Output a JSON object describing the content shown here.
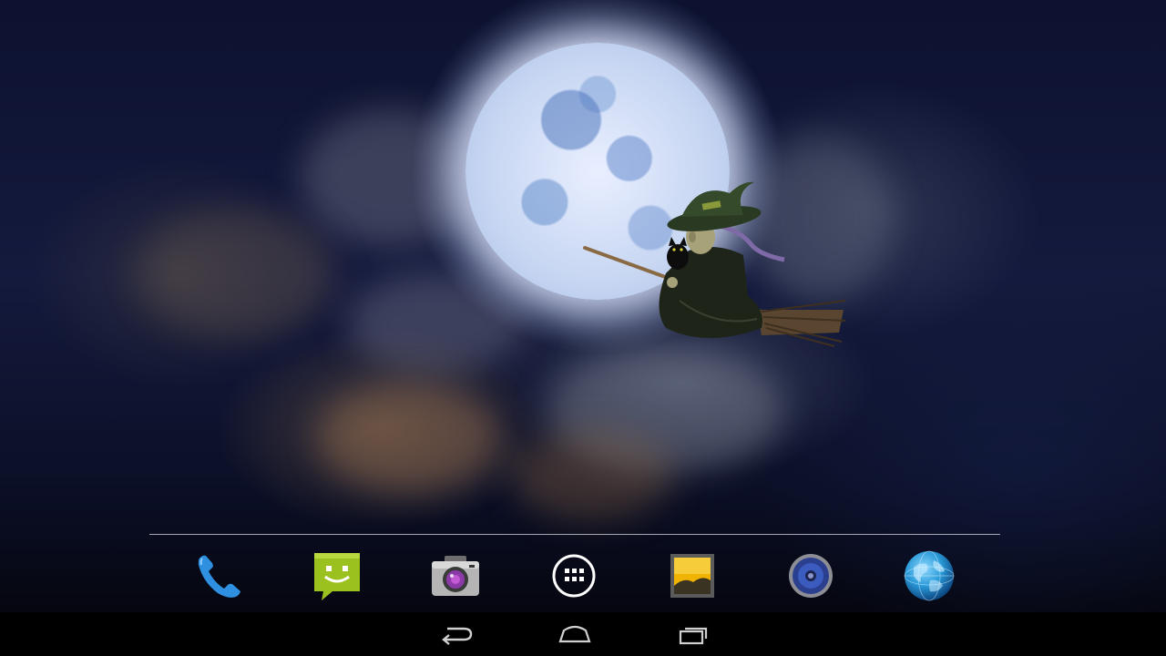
{
  "screen": {
    "wallpaper": "halloween-witch-moon-live-wallpaper"
  },
  "dock": {
    "items": [
      {
        "name": "phone",
        "icon": "phone-icon",
        "color": "#2f8fe0"
      },
      {
        "name": "messaging",
        "icon": "message-icon",
        "color": "#9bc11e"
      },
      {
        "name": "camera",
        "icon": "camera-icon",
        "color": "#9a9a9a"
      },
      {
        "name": "all-apps",
        "icon": "app-drawer-icon",
        "color": "#ffffff"
      },
      {
        "name": "gallery",
        "icon": "gallery-icon",
        "color": "#f0b400"
      },
      {
        "name": "music",
        "icon": "speaker-icon",
        "color": "#3b5bbf"
      },
      {
        "name": "browser",
        "icon": "globe-icon",
        "color": "#2a9ad8"
      }
    ]
  },
  "navbar": {
    "buttons": [
      {
        "name": "back",
        "icon": "back-arrow-icon"
      },
      {
        "name": "home",
        "icon": "home-icon"
      },
      {
        "name": "recents",
        "icon": "recent-apps-icon"
      }
    ]
  }
}
